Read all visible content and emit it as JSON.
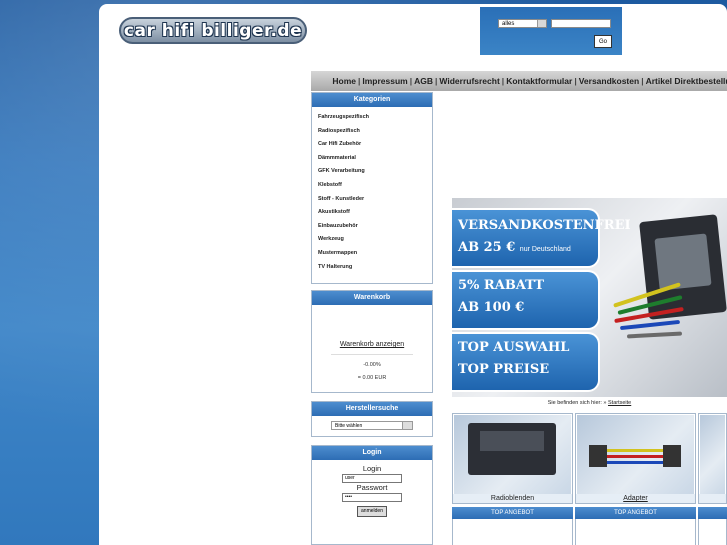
{
  "logo": {
    "text": "car hifi billiger.de"
  },
  "search": {
    "category_value": "alles",
    "input_value": "",
    "go_label": "Go"
  },
  "nav": {
    "links": [
      "Home",
      "Impressum",
      "AGB",
      "Widerrufsrecht",
      "Kontaktformular",
      "Versandkosten",
      "Artikel Direktbestellung"
    ],
    "separator": "|"
  },
  "categories": {
    "title": "Kategorien",
    "items": [
      "Fahrzeugspezifisch",
      "Radiospezifisch",
      "Car Hifi Zubehör",
      "Dämmmaterial",
      "GFK Verarbeitung",
      "Klebstoff",
      "Stoff - Kunstleder",
      "Akustikstoff",
      "Einbauzubehör",
      "Werkzeug",
      "Mustermappen",
      "TV Halterung"
    ]
  },
  "cart": {
    "title": "Warenkorb",
    "link": "Warenkorb anzeigen",
    "count": "-0.00%",
    "total": "= 0.00 EUR"
  },
  "manufacturer": {
    "title": "Herstellersuche",
    "selected": "Bitte wählen"
  },
  "login": {
    "title": "Login",
    "login_label": "Login",
    "user_value": "user",
    "password_label": "Passwort",
    "password_value": "••••",
    "submit": "anmelden"
  },
  "banner": {
    "line1": "VERSANDKOSTENFREI",
    "line2": "AB 25 €",
    "line2_small": "nur Deutschland",
    "line3": "5% RABATT",
    "line4": "AB 100 €",
    "line5": "TOP AUSWAHL",
    "line6": "TOP PREISE"
  },
  "breadcrumb": {
    "prefix": "Sie befinden sich hier: »",
    "link": "Startseite"
  },
  "tiles": [
    {
      "caption": "Radioblenden"
    },
    {
      "caption": "Adapter"
    },
    {
      "caption": ""
    }
  ],
  "offers": [
    {
      "label": "TOP ANGEBOT"
    },
    {
      "label": "TOP ANGEBOT"
    },
    {
      "label": ""
    }
  ],
  "colors": {
    "accent": "#2d6db4",
    "background": "#3178bd"
  }
}
